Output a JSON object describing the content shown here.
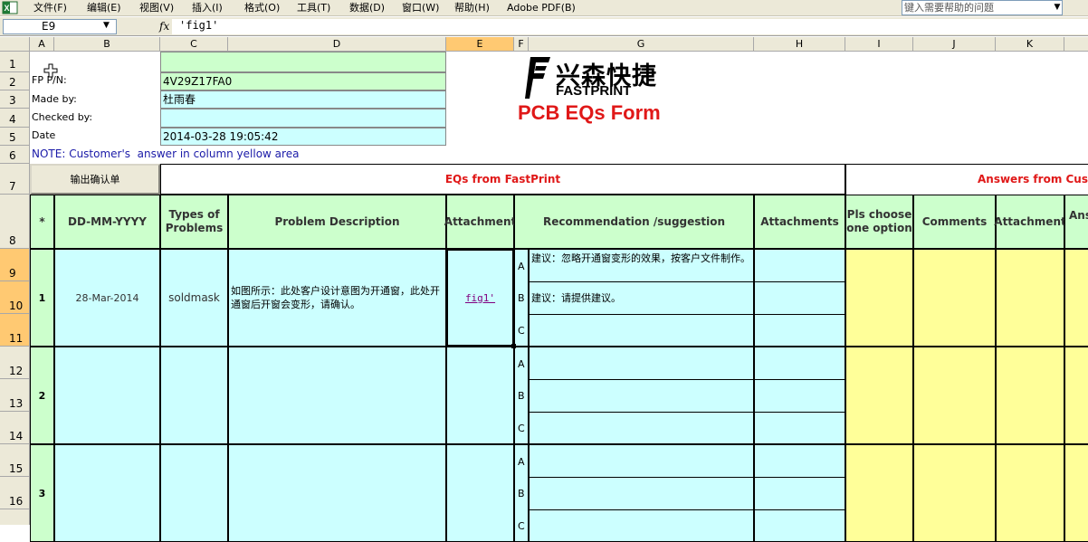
{
  "menu": {
    "items": [
      "文件(F)",
      "编辑(E)",
      "视图(V)",
      "插入(I)",
      "格式(O)",
      "工具(T)",
      "数据(D)",
      "窗口(W)",
      "帮助(H)",
      "Adobe PDF(B)"
    ],
    "help_placeholder": "键入需要帮助的问题"
  },
  "formula_bar": {
    "name_box": "E9",
    "fx": "fx",
    "formula": "'fig1'"
  },
  "columns": [
    "A",
    "B",
    "C",
    "D",
    "E",
    "F",
    "G",
    "H",
    "I",
    "J",
    "K"
  ],
  "rows": [
    "1",
    "2",
    "3",
    "4",
    "5",
    "6",
    "7",
    "8",
    "9",
    "10",
    "11",
    "12",
    "13",
    "14",
    "15",
    "16"
  ],
  "form": {
    "labels": {
      "fp_pn": "FP P/N:",
      "made_by": "Made by:",
      "checked_by": "Checked by:",
      "date": "Date"
    },
    "values": {
      "fp_pn": "4V29Z17FA0",
      "made_by": "杜雨春",
      "checked_by": "",
      "date": "2014-03-28 19:05:42"
    },
    "note": "NOTE: Customer's  answer in column yellow area",
    "export_button": "输出确认单",
    "logo_cn": "兴森快捷",
    "logo_en": "FASTPRINT",
    "form_title": "PCB EQs Form"
  },
  "sections": {
    "fastprint": "EQs from FastPrint",
    "customer": "Answers from Cus"
  },
  "table_headers": {
    "num": "*",
    "date": "DD-MM-YYYY",
    "types": "Types of Problems",
    "problem": "Problem Description",
    "attachment": "Attachment",
    "recommendation": "Recommendation /suggestion",
    "attachments": "Attachments",
    "choose": "Pls choose one option",
    "comments": "Comments",
    "cust_attachment": "Attachment",
    "answer": "Ans"
  },
  "eqs": [
    {
      "num": "1",
      "date": "28-Mar-2014",
      "type": "soldmask",
      "problem": "如图所示：此处客户设计意图为开通窗，此处开通窗后开窗会变形，请确认。",
      "attachment": "fig1'",
      "options": [
        {
          "letter": "A",
          "text": "建议：忽略开通窗变形的效果，按客户文件制作。"
        },
        {
          "letter": "B",
          "text": "建议：请提供建议。"
        },
        {
          "letter": "C",
          "text": ""
        }
      ]
    },
    {
      "num": "2",
      "date": "",
      "type": "",
      "problem": "",
      "attachment": "",
      "options": [
        {
          "letter": "A",
          "text": ""
        },
        {
          "letter": "B",
          "text": ""
        },
        {
          "letter": "C",
          "text": ""
        }
      ]
    },
    {
      "num": "3",
      "date": "",
      "type": "",
      "problem": "",
      "attachment": "",
      "options": [
        {
          "letter": "A",
          "text": ""
        },
        {
          "letter": "B",
          "text": ""
        },
        {
          "letter": "C",
          "text": ""
        }
      ]
    }
  ]
}
